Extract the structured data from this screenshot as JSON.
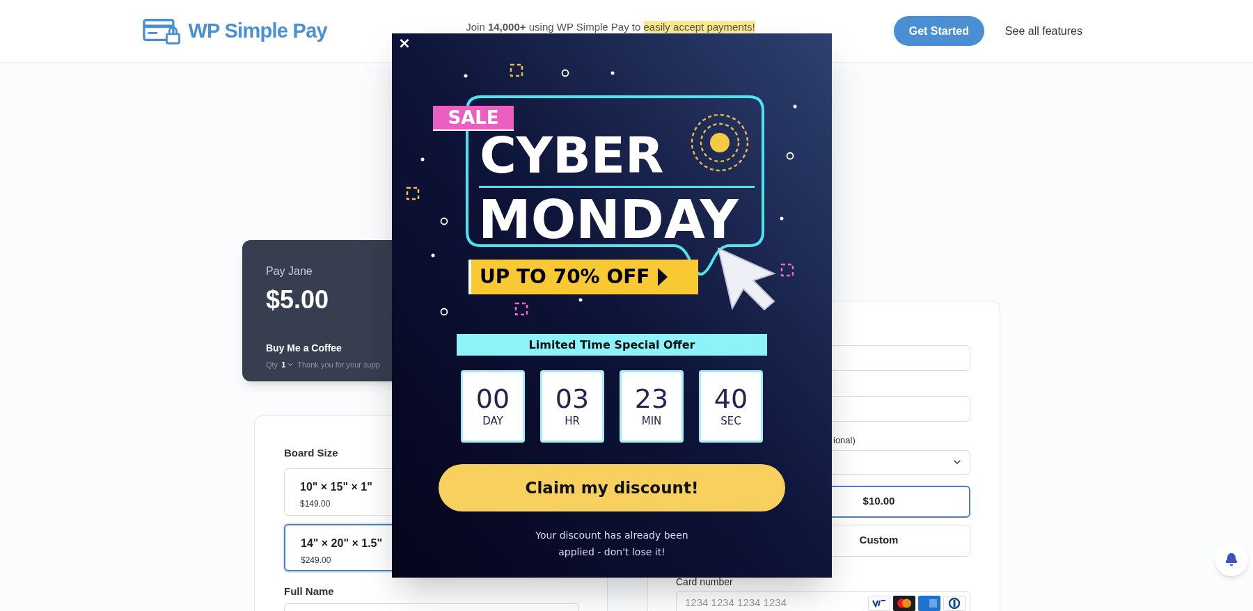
{
  "header": {
    "brand": "WP Simple Pay",
    "tagline": {
      "text": "Join **14,000+** using WP Simple Pay to",
      "highlight": "easily accept payments!"
    },
    "cta": "Get Started",
    "link": "See all features"
  },
  "pay_card": {
    "title": "Pay Jane",
    "amount": "$5.00",
    "item": "Buy Me a Coffee",
    "qty_label": "Qty",
    "qty_value": "1",
    "note": "Thank you for your supp"
  },
  "board_form": {
    "label": "Board Size",
    "options": [
      {
        "name": "10\" × 15\" × 1\"",
        "price": "$149.00",
        "selected": false
      },
      {
        "name": "14\" × 20\" × 1.5\"",
        "price": "$249.00",
        "selected": true
      }
    ],
    "full_name_label": "Full Name"
  },
  "payment_form": {
    "optional_label": "ional)",
    "amounts": [
      {
        "label": "$10.00",
        "selected": true
      },
      {
        "label": "Custom",
        "selected": false
      }
    ],
    "card_label": "Card number",
    "card_placeholder": "1234 1234 1234 1234"
  },
  "popup": {
    "close": "×",
    "tag": "SALE",
    "headline": [
      "CYBER",
      "MONDAY"
    ],
    "offer": "UP TO 70% OFF",
    "ribbon": "Limited Time Special Offer",
    "countdown": [
      {
        "value": "00",
        "unit": "DAY"
      },
      {
        "value": "03",
        "unit": "HR"
      },
      {
        "value": "23",
        "unit": "MIN"
      },
      {
        "value": "40",
        "unit": "SEC"
      }
    ],
    "button": "Claim my discount!",
    "footnote": "Your discount has already been applied - don't lose it!"
  }
}
